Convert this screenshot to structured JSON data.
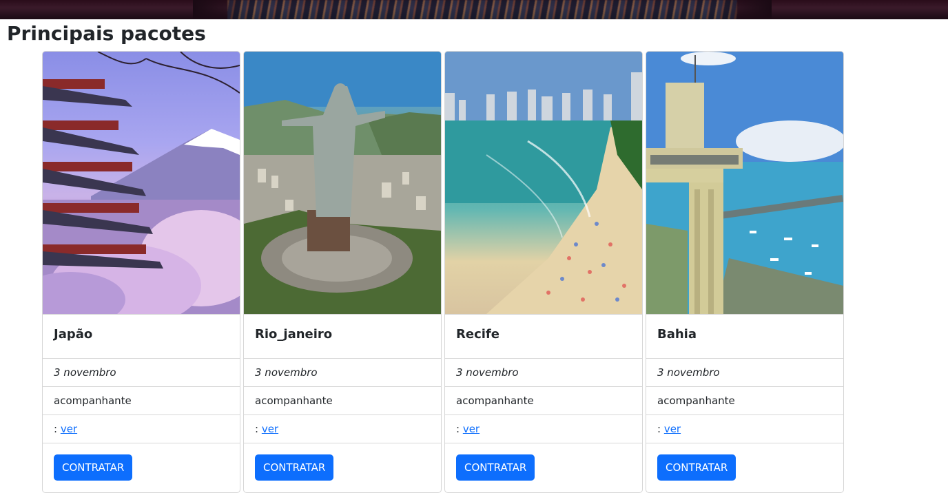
{
  "page": {
    "title": "Principais pacotes"
  },
  "cards": [
    {
      "title": "Japão",
      "date": "3 novembro",
      "companion": "acompanhante",
      "prefix": ": ",
      "link": "ver",
      "button": "CONTRATAR",
      "image": "japan-pagoda-fuji-photo"
    },
    {
      "title": "Rio_janeiro",
      "date": "3 novembro",
      "companion": "acompanhante",
      "prefix": ": ",
      "link": "ver",
      "button": "CONTRATAR",
      "image": "christ-the-redeemer-photo"
    },
    {
      "title": "Recife",
      "date": "3 novembro",
      "companion": "acompanhante",
      "prefix": ": ",
      "link": "ver",
      "button": "CONTRATAR",
      "image": "recife-beach-photo"
    },
    {
      "title": "Bahia",
      "date": "3 novembro",
      "companion": "acompanhante",
      "prefix": ": ",
      "link": "ver",
      "button": "CONTRATAR",
      "image": "lacerda-elevator-photo"
    }
  ],
  "colors": {
    "primary": "#0d6efd",
    "text": "#212529",
    "border": "#d6d6d6"
  }
}
